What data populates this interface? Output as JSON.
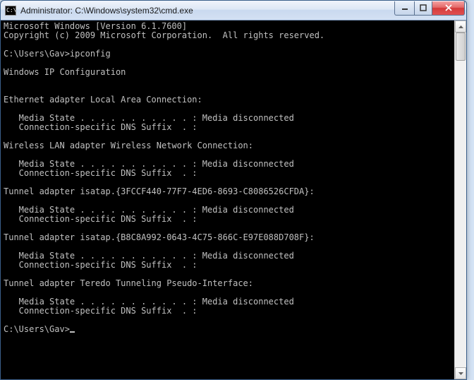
{
  "window": {
    "title": "Administrator: C:\\Windows\\system32\\cmd.exe",
    "icon_label": "C:\\"
  },
  "console": {
    "header1": "Microsoft Windows [Version 6.1.7600]",
    "header2": "Copyright (c) 2009 Microsoft Corporation.  All rights reserved.",
    "prompt1": "C:\\Users\\Gav>",
    "command1": "ipconfig",
    "section_title": "Windows IP Configuration",
    "adapters": [
      {
        "title": "Ethernet adapter Local Area Connection:",
        "media_line": "   Media State . . . . . . . . . . . : Media disconnected",
        "suffix_line": "   Connection-specific DNS Suffix  . :"
      },
      {
        "title": "Wireless LAN adapter Wireless Network Connection:",
        "media_line": "   Media State . . . . . . . . . . . : Media disconnected",
        "suffix_line": "   Connection-specific DNS Suffix  . :"
      },
      {
        "title": "Tunnel adapter isatap.{3FCCF440-77F7-4ED6-8693-C8086526CFDA}:",
        "media_line": "   Media State . . . . . . . . . . . : Media disconnected",
        "suffix_line": "   Connection-specific DNS Suffix  . :"
      },
      {
        "title": "Tunnel adapter isatap.{B8C8A992-0643-4C75-866C-E97E088D708F}:",
        "media_line": "   Media State . . . . . . . . . . . : Media disconnected",
        "suffix_line": "   Connection-specific DNS Suffix  . :"
      },
      {
        "title": "Tunnel adapter Teredo Tunneling Pseudo-Interface:",
        "media_line": "   Media State . . . . . . . . . . . : Media disconnected",
        "suffix_line": "   Connection-specific DNS Suffix  . :"
      }
    ],
    "prompt2": "C:\\Users\\Gav>"
  }
}
